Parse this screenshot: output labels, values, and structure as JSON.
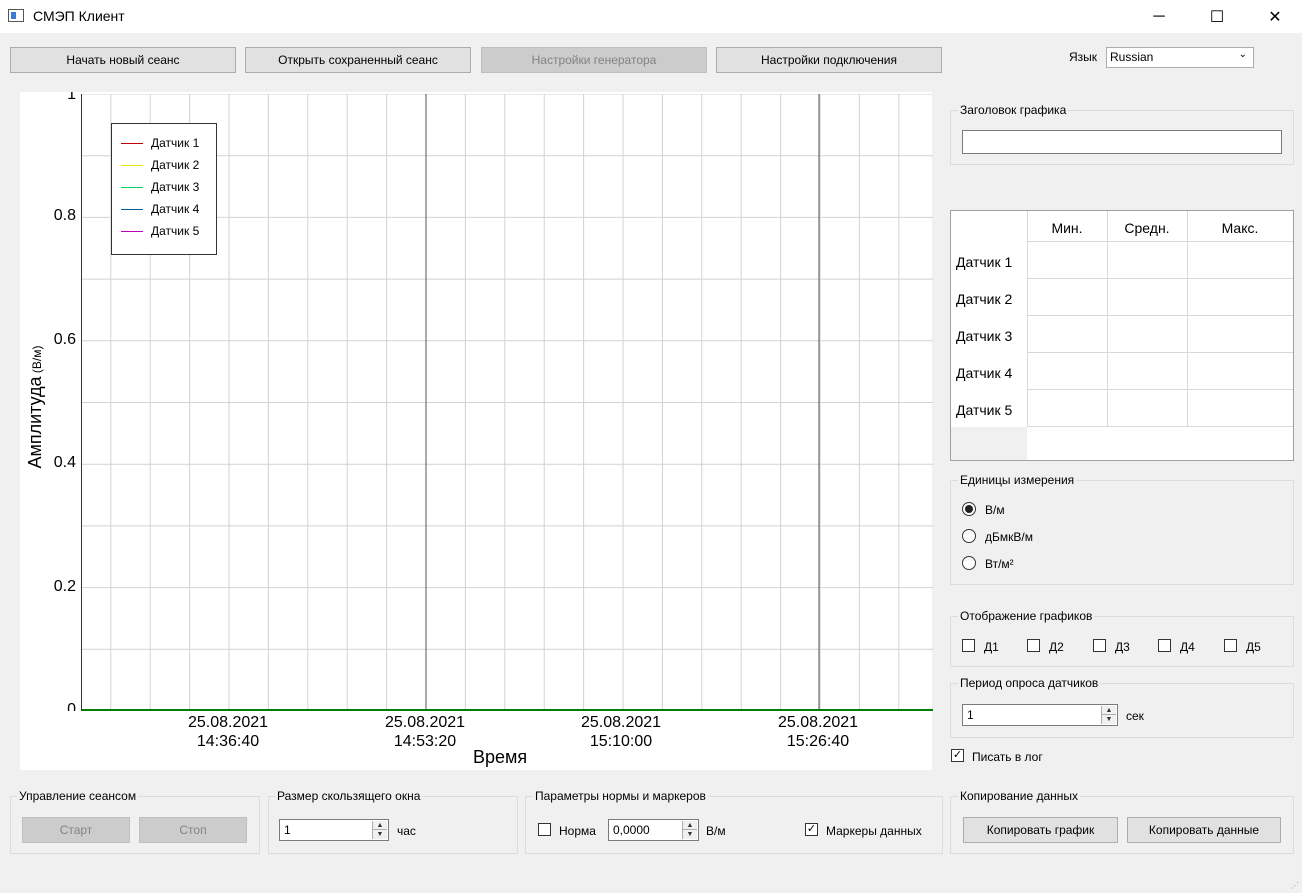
{
  "window": {
    "title": "СМЭП Клиент",
    "controls": {
      "minimize": "─",
      "maximize": "☐",
      "close": "✕"
    }
  },
  "toolbar": {
    "new_session": "Начать новый сеанс",
    "open_session": "Открыть сохраненный сеанс",
    "generator_settings": "Настройки генератора",
    "connection_settings": "Настройки подключения",
    "language_label": "Язык",
    "language_value": "Russian"
  },
  "chart_data": {
    "type": "line",
    "title": "",
    "xlabel": "Время",
    "ylabel": "Амплитуда",
    "ylabel_unit": "(В/м)",
    "ylim": [
      0,
      1
    ],
    "yticks": [
      "1",
      "0.8",
      "0.6",
      "0.4",
      "0.2",
      "0"
    ],
    "xticks": [
      {
        "date": "25.08.2021",
        "time": "14:36:40"
      },
      {
        "date": "25.08.2021",
        "time": "14:53:20"
      },
      {
        "date": "25.08.2021",
        "time": "15:10:00"
      },
      {
        "date": "25.08.2021",
        "time": "15:26:40"
      }
    ],
    "grid": true,
    "legend_position": "top-left",
    "series": [
      {
        "name": "Датчик 1",
        "color": "#c00000",
        "values": []
      },
      {
        "name": "Датчик 2",
        "color": "#e8e800",
        "values": []
      },
      {
        "name": "Датчик 3",
        "color": "#00d060",
        "values": []
      },
      {
        "name": "Датчик 4",
        "color": "#0060a0",
        "values": []
      },
      {
        "name": "Датчик 5",
        "color": "#c000c0",
        "values": []
      }
    ],
    "baseline_color": "#008000"
  },
  "title_group": {
    "label": "Заголовок графика",
    "value": ""
  },
  "stats_table": {
    "columns": [
      "Мин.",
      "Средн.",
      "Макс."
    ],
    "rows": [
      "Датчик 1",
      "Датчик 2",
      "Датчик 3",
      "Датчик 4",
      "Датчик 5"
    ]
  },
  "units_group": {
    "label": "Единицы измерения",
    "options": [
      {
        "label": "В/м",
        "selected": true
      },
      {
        "label": "дБмкВ/м",
        "selected": false
      },
      {
        "label": "Вт/м²",
        "selected": false
      }
    ]
  },
  "display_group": {
    "label": "Отображение графиков",
    "items": [
      {
        "label": "Д1",
        "checked": false
      },
      {
        "label": "Д2",
        "checked": false
      },
      {
        "label": "Д3",
        "checked": false
      },
      {
        "label": "Д4",
        "checked": false
      },
      {
        "label": "Д5",
        "checked": false
      }
    ]
  },
  "period_group": {
    "label": "Период опроса датчиков",
    "value": "1",
    "unit": "сек"
  },
  "log_checkbox": {
    "label": "Писать в лог",
    "checked": true
  },
  "session_group": {
    "label": "Управление сеансом",
    "start": "Старт",
    "stop": "Стоп"
  },
  "window_group": {
    "label": "Размер скользящего окна",
    "value": "1",
    "unit": "час"
  },
  "norm_group": {
    "label": "Параметры нормы и маркеров",
    "norm_label": "Норма",
    "norm_checked": false,
    "norm_value": "0,0000",
    "norm_unit": "В/м",
    "markers_label": "Маркеры данных",
    "markers_checked": true
  },
  "copy_group": {
    "label": "Копирование данных",
    "copy_chart": "Копировать график",
    "copy_data": "Копировать данные"
  }
}
